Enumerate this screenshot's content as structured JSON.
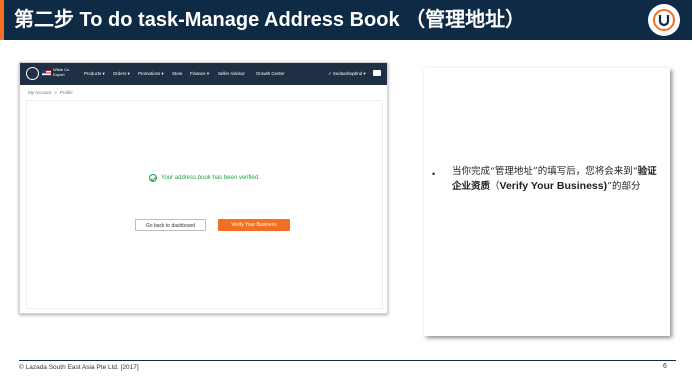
{
  "slide": {
    "title": "第二步 To do task-Manage Address Book （管理地址）",
    "footer": "© Lazada South East Asia Pte Ltd. [2017]",
    "page_number": "6",
    "colors": {
      "header_bg": "#0e2a44",
      "accent": "#f36f21",
      "success": "#22a34a"
    }
  },
  "screenshot": {
    "nav": {
      "store_line1": "Wilde Co",
      "store_line2": "Export",
      "items": [
        "Products ▾",
        "Orders ▾",
        "Promotions ▾",
        "Store",
        "Finance ▾",
        "Seller Advisor",
        "Growth Center"
      ],
      "user": "✓  Sedaxshopbnd ▾",
      "icons": [
        "lazada-logo-icon",
        "us-flag-icon",
        "mail-icon"
      ]
    },
    "breadcrumb": {
      "root": "My Account",
      "current": "Profile"
    },
    "message": "Your address book has been verified.",
    "back_button": "Go back to dashboard",
    "verify_button": "Verify Your Business"
  },
  "note": {
    "bullet": "•",
    "text_part1": "当你完成“管理地址”的填写后，您将会来到“",
    "text_bold_cn": "验证企业资质",
    "text_part2": "（",
    "text_bold_en": "Verify Your Business)",
    "text_part3": "”的部分"
  }
}
